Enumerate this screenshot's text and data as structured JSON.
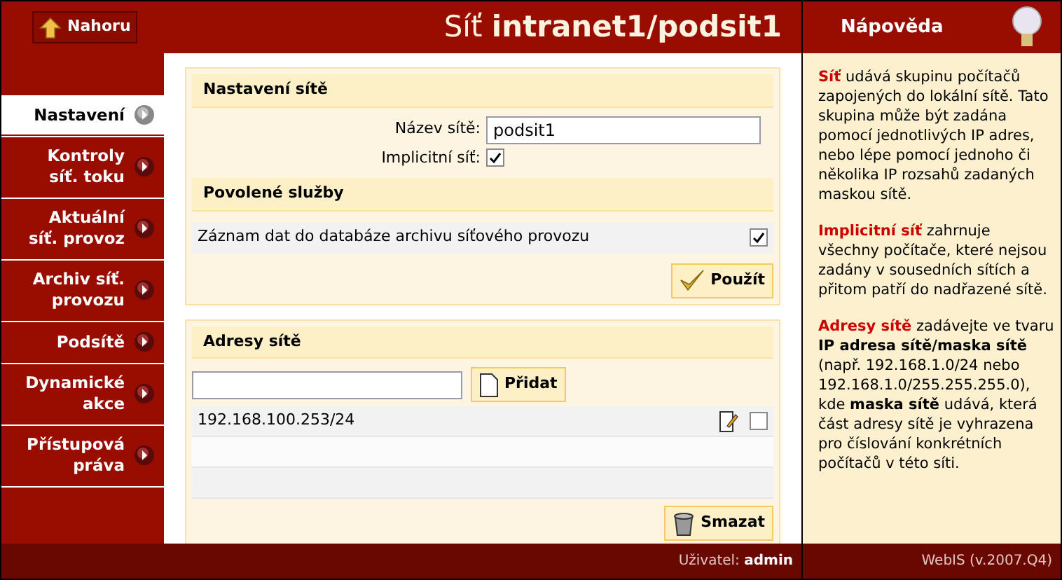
{
  "top_bar": {
    "up_button": "Nahoru",
    "title": "Síť **intranet1/podsit1**"
  },
  "sidebar": {
    "items": [
      {
        "label": "Nastavení",
        "selected": true
      },
      {
        "label": "Kontroly síť. toku",
        "selected": false
      },
      {
        "label": "Aktuální síť. provoz",
        "selected": false
      },
      {
        "label": "Archiv síť. provozu",
        "selected": false
      },
      {
        "label": "Podsítě",
        "selected": false
      },
      {
        "label": "Dynamické akce",
        "selected": false
      },
      {
        "label": "Přístupová práva",
        "selected": false
      }
    ]
  },
  "settings_panel": {
    "title": "Nastavení sítě",
    "name_label": "Název sítě:",
    "name_value": "podsit1",
    "default_label": "Implicitní síť:",
    "default_checked": true,
    "services_title": "Povolené služby",
    "services": [
      {
        "label": "Záznam dat do databáze archivu síťového provozu",
        "checked": true
      }
    ],
    "apply_button": "Použít"
  },
  "addresses_panel": {
    "title": "Adresy sítě",
    "add_button": "Přidat",
    "rows": [
      {
        "address": "192.168.100.253/24",
        "checked": false
      }
    ],
    "delete_button": "Smazat"
  },
  "help": {
    "title": "Nápověda",
    "paragraphs": [
      {
        "term": "Síť",
        "lines": [
          "udává skupinu počítačů zapojených do lokální sítě. Tato skupina může být zadána pomocí jednotlivých IP adres, nebo lépe pomocí jednoho či několika IP rozsahů zadaných maskou sítě."
        ]
      },
      {
        "term": "Implicitní síť",
        "lines": [
          "zahrnuje všechny počítače, které nejsou zadány v sousedních sítích a přitom patří do nadřazené sítě."
        ]
      },
      {
        "term": "Adresy sítě",
        "lines": [
          "zadávejte ve tvaru **IP adresa sítě/maska sítě**",
          "(např. 192.168.1.0/24 nebo 192.168.1.0/255.255.255.0), kde **maska sítě** udává, která část adresy sítě je vyhrazena pro číslování konkrétních počítačů v této síti."
        ]
      }
    ]
  },
  "footer": {
    "user_label": "Uživatel:",
    "user": "admin",
    "version": "WebIS (v.2007.Q4)"
  }
}
